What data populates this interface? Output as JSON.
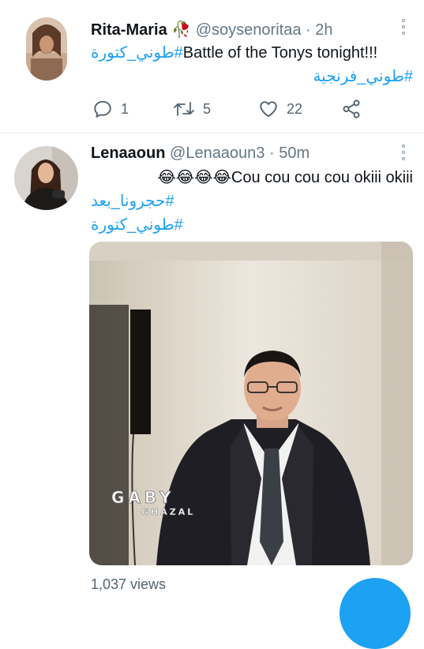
{
  "tweets": [
    {
      "display_name": "Rita-Maria",
      "name_emoji": "🥀",
      "handle": "@soysenoritaa",
      "separator": "·",
      "time": "2h",
      "line1_tag": "#طوني_كتورة",
      "line1_text": "Battle of the Tonys tonight!!!",
      "line2_tag": "#طوني_فرنجية",
      "reply_count": "1",
      "retweet_count": "5",
      "like_count": "22"
    },
    {
      "display_name": "Lenaaoun",
      "handle": "@Lenaaoun3",
      "separator": "·",
      "time": "50m",
      "emojis": "😂😂😂😂",
      "line1_text": "Cou cou cou cou okiii okiii",
      "line2_text": "حجرونا_بعد#",
      "line3_tag": "طوني_كتورة#",
      "watermark_line1": "GABY",
      "watermark_line2": "GHAZAL",
      "views": "1,037 views"
    }
  ],
  "icons": [
    "reply-icon",
    "retweet-icon",
    "like-icon",
    "share-icon",
    "more-icon"
  ],
  "colors": {
    "link": "#1da1f2",
    "text": "#0f1419",
    "muted": "#657786",
    "divider": "#e6ecf0"
  }
}
